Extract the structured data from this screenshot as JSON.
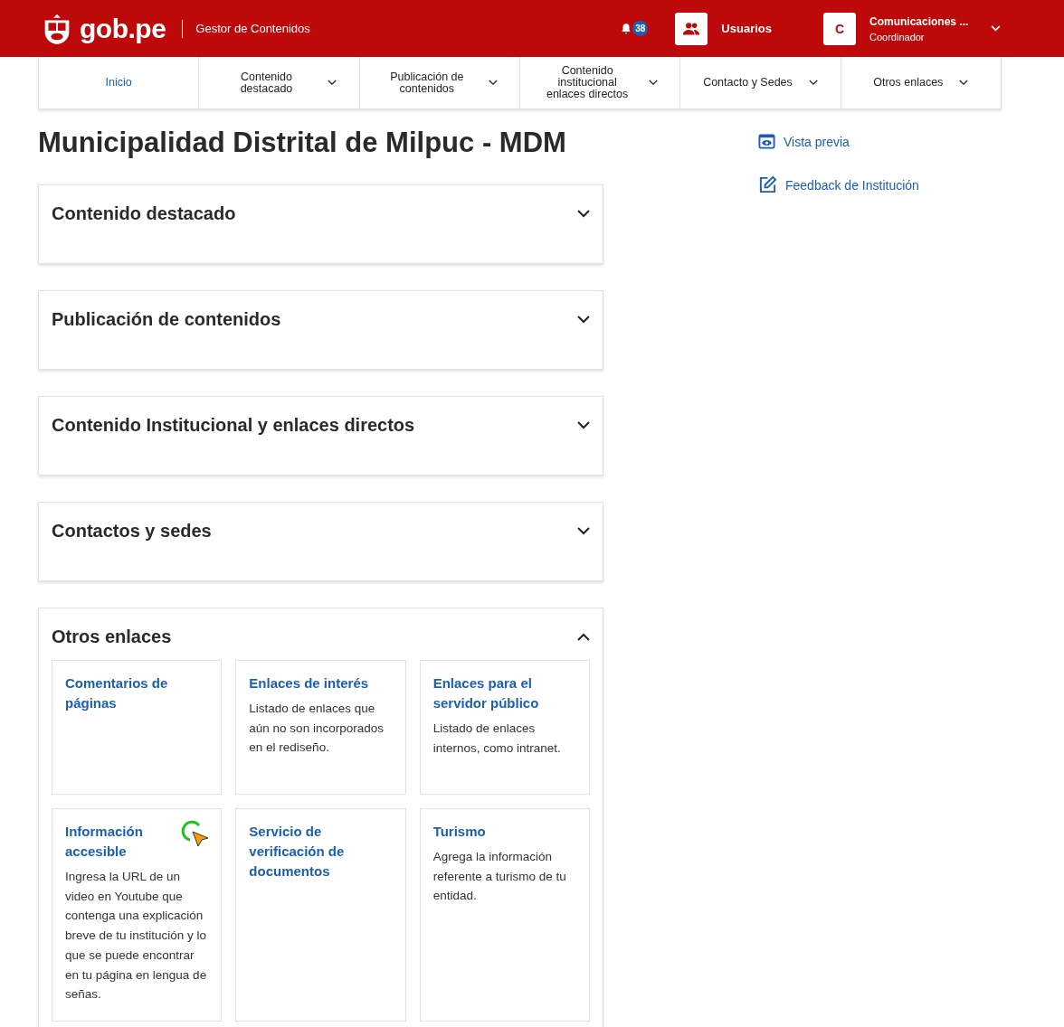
{
  "header": {
    "logo_text": "gob.pe",
    "app_name": "Gestor de Contenidos",
    "notification_count": "38",
    "users_label": "Usuarios",
    "account": {
      "initial": "C",
      "name": "Comunicaciones ...",
      "role": "Coordinador"
    }
  },
  "nav": [
    {
      "label": "Inicio",
      "selected": true,
      "dropdown": false
    },
    {
      "label": "Contenido destacado",
      "selected": false,
      "dropdown": true
    },
    {
      "label": "Publicación de contenidos",
      "selected": false,
      "dropdown": true
    },
    {
      "label": "Contenido institucional enlaces directos",
      "selected": false,
      "dropdown": true
    },
    {
      "label": "Contacto y Sedes",
      "selected": false,
      "dropdown": true
    },
    {
      "label": "Otros enlaces",
      "selected": false,
      "dropdown": true
    }
  ],
  "page_title": "Municipalidad Distrital de Milpuc - MDM",
  "sections": [
    {
      "title": "Contenido destacado",
      "expanded": false
    },
    {
      "title": "Publicación de contenidos",
      "expanded": false
    },
    {
      "title": "Contenido Institucional y enlaces directos",
      "expanded": false
    },
    {
      "title": "Contactos y sedes",
      "expanded": false
    },
    {
      "title": "Otros enlaces",
      "expanded": true,
      "cards": [
        {
          "title": "Comentarios de páginas"
        },
        {
          "title": "Enlaces de interés",
          "description": "Listado de enlaces que aún no son incorporados en el rediseño."
        },
        {
          "title": "Enlaces para el servidor público",
          "description": "Listado de enlaces internos, como intranet."
        },
        {
          "title": "Información accesible",
          "description": "Ingresa la URL de un video en Youtube que contenga una explicación breve de tu institución y lo que se puede encontrar en tu página en lengua de señas.",
          "cursor": true
        },
        {
          "title": "Servicio de verificación de documentos"
        },
        {
          "title": "Turismo",
          "description": "Agrega la información referente a turismo de tu entidad."
        }
      ]
    }
  ],
  "side_links": [
    {
      "kind": "preview",
      "label": "Vista previa"
    },
    {
      "kind": "feedback",
      "label": "Feedback de Institución"
    }
  ]
}
